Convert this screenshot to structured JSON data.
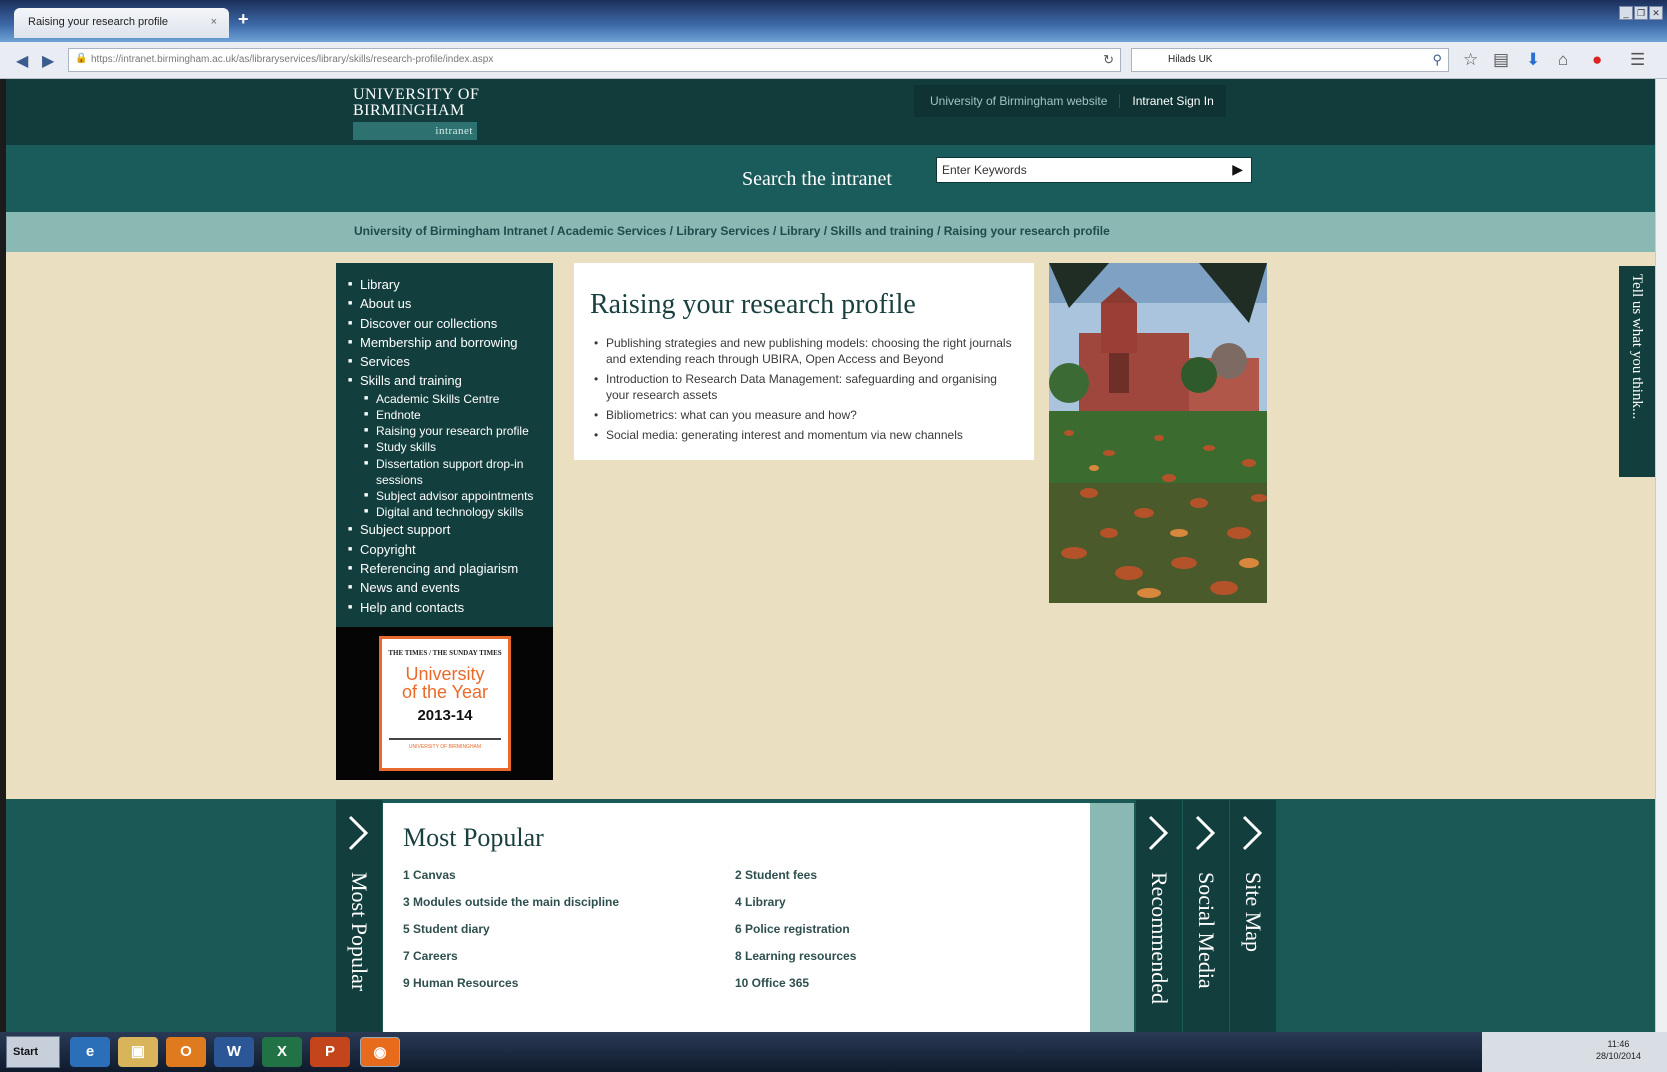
{
  "browser": {
    "tab_title": "Raising your research profile",
    "tab_close": "×",
    "new_tab": "+",
    "url": "https://intranet.birmingham.ac.uk/as/libraryservices/library/skills/research-profile/index.aspx",
    "search_engine_text": "Hilads UK",
    "window_buttons": [
      "_",
      "❐",
      "✕"
    ]
  },
  "site": {
    "logo_line1": "UNIVERSITY OF",
    "logo_line2": "BIRMINGHAM",
    "logo_sub": "intranet",
    "top_links": {
      "website": "University of Birmingham website",
      "sign_in": "Intranet Sign In"
    },
    "search_label": "Search the intranet",
    "search_placeholder": "Enter Keywords",
    "breadcrumb": "University of Birmingham Intranet / Academic Services / Library Services / Library / Skills and training / Raising your research profile"
  },
  "leftnav": {
    "items": [
      {
        "label": "Library",
        "level": 1
      },
      {
        "label": "About us",
        "level": 1
      },
      {
        "label": "Discover our collections",
        "level": 1
      },
      {
        "label": "Membership and borrowing",
        "level": 1
      },
      {
        "label": "Services",
        "level": 1
      },
      {
        "label": "Skills and training",
        "level": 1
      },
      {
        "label": "Academic Skills Centre",
        "level": 2
      },
      {
        "label": "Endnote",
        "level": 2
      },
      {
        "label": "Raising your research profile",
        "level": 2
      },
      {
        "label": "Study skills",
        "level": 2
      },
      {
        "label": "Dissertation support drop-in sessions",
        "level": 2
      },
      {
        "label": "Subject advisor appointments",
        "level": 2
      },
      {
        "label": "Digital and technology skills",
        "level": 2
      },
      {
        "label": "Subject support",
        "level": 1
      },
      {
        "label": "Copyright",
        "level": 1
      },
      {
        "label": "Referencing and plagiarism",
        "level": 1
      },
      {
        "label": "News and events",
        "level": 1
      },
      {
        "label": "Help and contacts",
        "level": 1
      }
    ]
  },
  "award": {
    "masthead": "THE TIMES / THE SUNDAY TIMES",
    "line1": "University",
    "line2": "of the Year",
    "year": "2013-14",
    "sub": "UNIVERSITY OF BIRMINGHAM"
  },
  "main": {
    "title": "Raising your research profile",
    "items": [
      "Publishing strategies and new publishing models: choosing the right journals and extending reach through UBIRA, Open Access and Beyond",
      "Introduction to Research Data Management: safeguarding and organising your research assets",
      "Bibliometrics: what can you measure and how?",
      "Social media: generating interest and momentum via new channels"
    ]
  },
  "feedback_tab": "Tell us what you think...",
  "footer": {
    "tabs": {
      "most_popular": "Most Popular",
      "recommended": "Recommended",
      "social_media": "Social Media",
      "site_map": "Site Map"
    },
    "popular_title": "Most Popular",
    "popular": [
      "1 Canvas",
      "2 Student fees",
      "3 Modules outside the main discipline",
      "4 Library",
      "5 Student diary",
      "6 Police registration",
      "7 Careers",
      "8 Learning resources",
      "9 Human Resources",
      "10 Office 365"
    ]
  },
  "taskbar": {
    "start": "Start",
    "apps": [
      "ie-icon",
      "folder-icon",
      "outlook-icon",
      "word-icon",
      "excel-icon",
      "powerpoint-icon",
      "firefox-icon"
    ],
    "time": "11:46",
    "date": "28/10/2014"
  },
  "colors": {
    "dark_teal": "#133e3e",
    "mid_teal": "#1a5c5b",
    "light_teal": "#8ab8b3",
    "beige": "#ebdfc2",
    "accent_orange": "#e8692b"
  }
}
